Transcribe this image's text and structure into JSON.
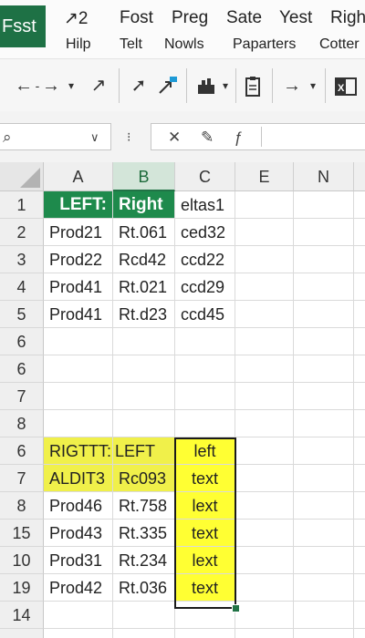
{
  "ribbon": {
    "file_tab": "Fsst",
    "top_row": [
      {
        "id": "arrow2",
        "label": "↗2"
      },
      {
        "id": "fost",
        "label": "Fost"
      },
      {
        "id": "preg",
        "label": "Preg"
      },
      {
        "id": "sate",
        "label": "Sate"
      },
      {
        "id": "yest",
        "label": "Yest"
      },
      {
        "id": "righ",
        "label": "Righ"
      }
    ],
    "bottom_row": [
      {
        "id": "hilp",
        "label": "Hilp"
      },
      {
        "id": "telt",
        "label": "Telt"
      },
      {
        "id": "nowls",
        "label": "Nowls"
      },
      {
        "id": "paparters",
        "label": "Paparters"
      },
      {
        "id": "cotter",
        "label": "Cotter"
      }
    ]
  },
  "formula_bar": {
    "name_box": "",
    "formula": ""
  },
  "columns": [
    "A",
    "B",
    "C",
    "E",
    "N"
  ],
  "selected_column": "B",
  "rows": [
    {
      "num": "1",
      "a": "LEFT:",
      "b": "Right",
      "c": "eltas1"
    },
    {
      "num": "2",
      "a": "Prod21",
      "b": "Rt.061",
      "c": "ced32"
    },
    {
      "num": "3",
      "a": "Prod22",
      "b": "Rcd42",
      "c": "ccd22"
    },
    {
      "num": "4",
      "a": "Prod41",
      "b": "Rt.021",
      "c": "ccd29"
    },
    {
      "num": "5",
      "a": "Prod41",
      "b": "Rt.d23",
      "c": "ccd45"
    },
    {
      "num": "6",
      "a": "",
      "b": "",
      "c": ""
    },
    {
      "num": "6",
      "a": "",
      "b": "",
      "c": ""
    },
    {
      "num": "7",
      "a": "",
      "b": "",
      "c": ""
    },
    {
      "num": "8",
      "a": "",
      "b": "",
      "c": ""
    },
    {
      "num": "6",
      "a": "RIGTTT: .",
      "b": "LEFT",
      "c": "left"
    },
    {
      "num": "7",
      "a": "ALDIT3",
      "b": "Rc093",
      "c": "text"
    },
    {
      "num": "8",
      "a": "Prod46",
      "b": "Rt.758",
      "c": "lext"
    },
    {
      "num": "15",
      "a": "Prod43",
      "b": "Rt.335",
      "c": "text"
    },
    {
      "num": "10",
      "a": "Prod31",
      "b": "Rt.234",
      "c": "lext"
    },
    {
      "num": "19",
      "a": "Prod42",
      "b": "Rt.036",
      "c": "text"
    },
    {
      "num": "14",
      "a": "",
      "b": "",
      "c": ""
    },
    {
      "num": "",
      "a": "",
      "b": "",
      "c": ""
    }
  ],
  "colors": {
    "excel_green": "#1e7145",
    "header_green_fill": "#1e8a4c",
    "highlight_yellow": "#ffff33"
  },
  "icons": [
    "undo-icon",
    "redo-icon",
    "dropdown-icon",
    "expand-arrow-icon",
    "pointer-icon",
    "link-icon",
    "paint-icon",
    "paste-icon",
    "arrow-right-icon",
    "excel-app-icon",
    "search-icon",
    "cancel-icon",
    "edit-pen-icon",
    "function-icon"
  ]
}
